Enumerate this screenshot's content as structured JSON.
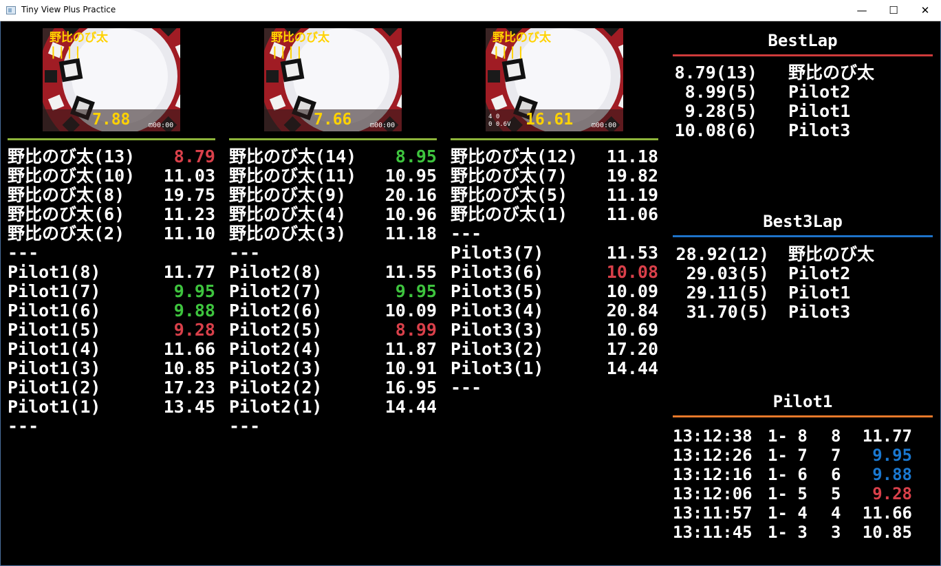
{
  "window": {
    "title": "Tiny View Plus Practice",
    "minimize": "—",
    "maximize": "☐",
    "close": "✕"
  },
  "colors": {
    "yellow": "#ffd200",
    "green": "#3ec43e",
    "red": "#d9404a",
    "blue": "#1a78d0",
    "separator": "#8db43a",
    "bestlap_rule": "#cf3b3b",
    "best3lap_rule": "#1e73c9",
    "pilot_rule": "#e8792a"
  },
  "cameras": [
    {
      "name": "野比のび太",
      "bars": "||||",
      "time": "7.88",
      "osd": "⊡00:00",
      "osd2": ""
    },
    {
      "name": "野比のび太",
      "bars": "||||",
      "time": "7.66",
      "osd": "⊡00:00",
      "osd2": ""
    },
    {
      "name": "野比のび太",
      "bars": "||||",
      "time": "16.61",
      "osd": "⊡00:00",
      "osd2": "4 0\n0 0.6V"
    }
  ],
  "columns": [
    {
      "rows": [
        {
          "label": "野比のび太(13)",
          "value": "8.79",
          "color": "red"
        },
        {
          "label": "野比のび太(10)",
          "value": "11.03",
          "color": "white"
        },
        {
          "label": "野比のび太(8)",
          "value": "19.75",
          "color": "white"
        },
        {
          "label": "野比のび太(6)",
          "value": "11.23",
          "color": "white"
        },
        {
          "label": "野比のび太(2)",
          "value": "11.10",
          "color": "white"
        },
        {
          "label": "---",
          "value": "",
          "color": "white"
        },
        {
          "label": "Pilot1(8)",
          "value": "11.77",
          "color": "white"
        },
        {
          "label": "Pilot1(7)",
          "value": "9.95",
          "color": "green"
        },
        {
          "label": "Pilot1(6)",
          "value": "9.88",
          "color": "green"
        },
        {
          "label": "Pilot1(5)",
          "value": "9.28",
          "color": "red"
        },
        {
          "label": "Pilot1(4)",
          "value": "11.66",
          "color": "white"
        },
        {
          "label": "Pilot1(3)",
          "value": "10.85",
          "color": "white"
        },
        {
          "label": "Pilot1(2)",
          "value": "17.23",
          "color": "white"
        },
        {
          "label": "Pilot1(1)",
          "value": "13.45",
          "color": "white"
        },
        {
          "label": "---",
          "value": "",
          "color": "white"
        }
      ]
    },
    {
      "rows": [
        {
          "label": "野比のび太(14)",
          "value": "8.95",
          "color": "green"
        },
        {
          "label": "野比のび太(11)",
          "value": "10.95",
          "color": "white"
        },
        {
          "label": "野比のび太(9)",
          "value": "20.16",
          "color": "white"
        },
        {
          "label": "野比のび太(4)",
          "value": "10.96",
          "color": "white"
        },
        {
          "label": "野比のび太(3)",
          "value": "11.18",
          "color": "white"
        },
        {
          "label": "---",
          "value": "",
          "color": "white"
        },
        {
          "label": "Pilot2(8)",
          "value": "11.55",
          "color": "white"
        },
        {
          "label": "Pilot2(7)",
          "value": "9.95",
          "color": "green"
        },
        {
          "label": "Pilot2(6)",
          "value": "10.09",
          "color": "white"
        },
        {
          "label": "Pilot2(5)",
          "value": "8.99",
          "color": "red"
        },
        {
          "label": "Pilot2(4)",
          "value": "11.87",
          "color": "white"
        },
        {
          "label": "Pilot2(3)",
          "value": "10.91",
          "color": "white"
        },
        {
          "label": "Pilot2(2)",
          "value": "16.95",
          "color": "white"
        },
        {
          "label": "Pilot2(1)",
          "value": "14.44",
          "color": "white"
        },
        {
          "label": "---",
          "value": "",
          "color": "white"
        }
      ]
    },
    {
      "rows": [
        {
          "label": "野比のび太(12)",
          "value": "11.18",
          "color": "white"
        },
        {
          "label": "野比のび太(7)",
          "value": "19.82",
          "color": "white"
        },
        {
          "label": "野比のび太(5)",
          "value": "11.19",
          "color": "white"
        },
        {
          "label": "野比のび太(1)",
          "value": "11.06",
          "color": "white"
        },
        {
          "label": "---",
          "value": "",
          "color": "white"
        },
        {
          "label": "Pilot3(7)",
          "value": "11.53",
          "color": "white"
        },
        {
          "label": "Pilot3(6)",
          "value": "10.08",
          "color": "red"
        },
        {
          "label": "Pilot3(5)",
          "value": "10.09",
          "color": "white"
        },
        {
          "label": "Pilot3(4)",
          "value": "20.84",
          "color": "white"
        },
        {
          "label": "Pilot3(3)",
          "value": "10.69",
          "color": "white"
        },
        {
          "label": "Pilot3(2)",
          "value": "17.20",
          "color": "white"
        },
        {
          "label": "Pilot3(1)",
          "value": "14.44",
          "color": "white"
        },
        {
          "label": "---",
          "value": "",
          "color": "white"
        }
      ]
    }
  ],
  "bestlap": {
    "title": "BestLap",
    "rows": [
      {
        "value": "8.79(13)",
        "name": "野比のび太"
      },
      {
        "value": "8.99(5)",
        "name": "Pilot2"
      },
      {
        "value": "9.28(5)",
        "name": "Pilot1"
      },
      {
        "value": "10.08(6)",
        "name": "Pilot3"
      }
    ]
  },
  "best3lap": {
    "title": "Best3Lap",
    "rows": [
      {
        "value": "28.92(12)",
        "name": "野比のび太"
      },
      {
        "value": "29.03(5)",
        "name": "Pilot2"
      },
      {
        "value": "29.11(5)",
        "name": "Pilot1"
      },
      {
        "value": "31.70(5)",
        "name": "Pilot3"
      }
    ]
  },
  "pilot_panel": {
    "title": "Pilot1",
    "rows": [
      {
        "time": "13:12:38",
        "heat": "1- 8",
        "lap": "8",
        "value": "11.77",
        "color": "white"
      },
      {
        "time": "13:12:26",
        "heat": "1- 7",
        "lap": "7",
        "value": "9.95",
        "color": "blue"
      },
      {
        "time": "13:12:16",
        "heat": "1- 6",
        "lap": "6",
        "value": "9.88",
        "color": "blue"
      },
      {
        "time": "13:12:06",
        "heat": "1- 5",
        "lap": "5",
        "value": "9.28",
        "color": "red"
      },
      {
        "time": "13:11:57",
        "heat": "1- 4",
        "lap": "4",
        "value": "11.66",
        "color": "white"
      },
      {
        "time": "13:11:45",
        "heat": "1- 3",
        "lap": "3",
        "value": "10.85",
        "color": "white"
      }
    ]
  }
}
